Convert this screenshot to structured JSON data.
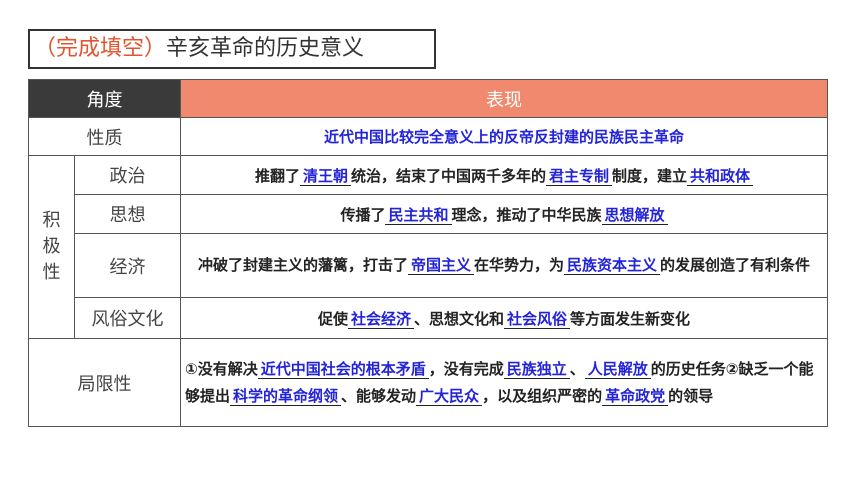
{
  "title": {
    "part1": "（完成填空）",
    "part2": "辛亥革命的历史意义"
  },
  "header": {
    "col1": "角度",
    "col2": "表现"
  },
  "nature": {
    "label": "性质",
    "value": "近代中国比较完全意义上的反帝反封建的民族民主革命"
  },
  "positive": {
    "label_chars": [
      "积",
      "极",
      "性"
    ]
  },
  "politics": {
    "label": "政治",
    "t1": "推翻了",
    "b1": "清王朝",
    "t2": "统治，结束了中国两千多年的",
    "b2": "君主专制",
    "t3": "制度，建立",
    "b3": "共和政体"
  },
  "thought": {
    "label": "思想",
    "t1": "传播了",
    "b1": "民主共和",
    "t2": "理念，推动了中华民族",
    "b2": "思想解放"
  },
  "economy": {
    "label": "经济",
    "t1": "冲破了封建主义的藩篱，打击了",
    "b1": "帝国主义",
    "t2": "在华势力，为",
    "b2": "民族资本主义",
    "t3": "的发展创造了有利条件"
  },
  "customs": {
    "label": "风俗文化",
    "t1": "促使",
    "b1": "社会经济",
    "t2": "、思想文化和",
    "b2": "社会风俗",
    "t3": "等方面发生新变化"
  },
  "limit": {
    "label": "局限性",
    "t1": "①没有解决",
    "b1": "近代中国社会的根本矛盾",
    "t2": "，没有完成",
    "b2": "民族独立",
    "t3": "、",
    "b3": "人民解放",
    "t4": "的历史任务②缺乏一个能够提出",
    "b4": "科学的革命纲领",
    "t5": "、能够发动",
    "b5": "广大民众",
    "t6": "，以及组织严密的",
    "b6": "革命政党",
    "t7": "的领导"
  }
}
